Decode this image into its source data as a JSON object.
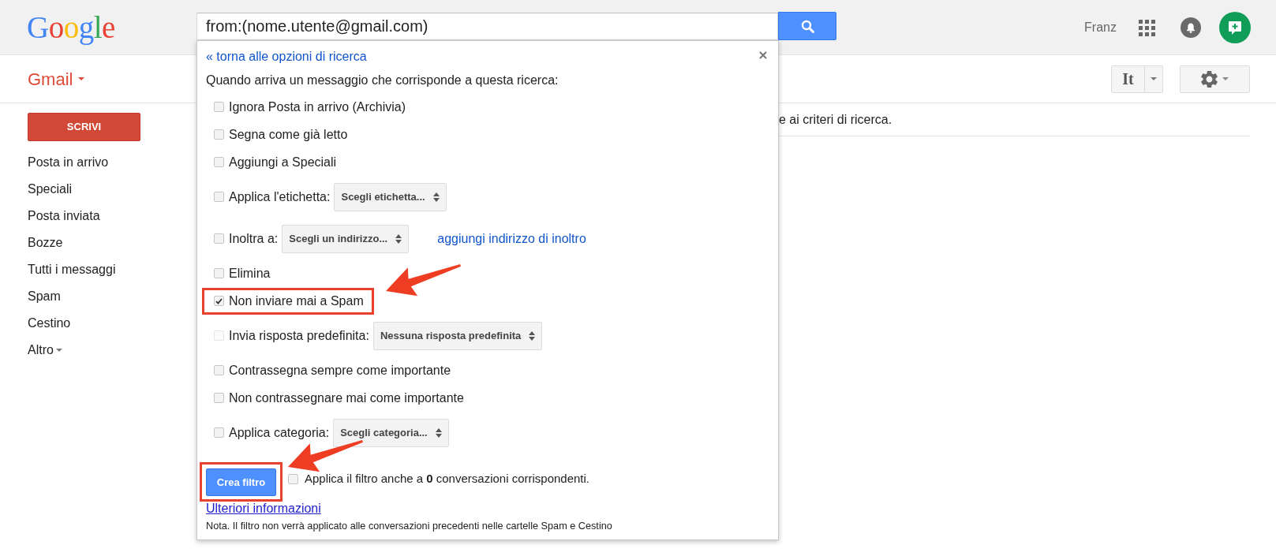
{
  "header": {
    "logo": "Google",
    "search": {
      "value": "from:(nome.utente@gmail.com)"
    },
    "user_name": "Franz"
  },
  "toolbar": {
    "app_menu": "Gmail",
    "input_tools": "It"
  },
  "sidebar": {
    "compose_button": "SCRIVI",
    "items": [
      {
        "label": "Posta in arrivo",
        "kind": "folder",
        "selected": false
      },
      {
        "label": "Speciali",
        "kind": "folder",
        "selected": false
      },
      {
        "label": "Posta inviata",
        "kind": "folder",
        "selected": false
      },
      {
        "label": "Bozze",
        "kind": "folder",
        "selected": false
      },
      {
        "label": "Tutti i messaggi",
        "kind": "folder",
        "selected": false
      },
      {
        "label": "Spam",
        "kind": "folder",
        "selected": false
      },
      {
        "label": "Cestino",
        "kind": "folder",
        "selected": false
      },
      {
        "label": "Altro",
        "kind": "dropdown",
        "selected": false
      }
    ]
  },
  "main": {
    "message": "e ai criteri di ricerca."
  },
  "filter_dialog": {
    "back_link": "« torna alle opzioni di ricerca",
    "intro": "Quando arriva un messaggio che corrisponde a questa ricerca:",
    "options": [
      {
        "kind": "plain",
        "label": "Ignora Posta in arrivo (Archivia)",
        "checked": false,
        "disabled": false,
        "highlighted": false
      },
      {
        "kind": "plain",
        "label": "Segna come già letto",
        "checked": false,
        "disabled": false,
        "highlighted": false
      },
      {
        "kind": "plain",
        "label": "Aggiungi a Speciali",
        "checked": false,
        "disabled": false,
        "highlighted": false
      },
      {
        "kind": "select",
        "label": "Applica l'etichetta:",
        "select": "Scegli etichetta...",
        "checked": false,
        "disabled": false,
        "highlighted": false
      },
      {
        "kind": "select",
        "label": "Inoltra a:",
        "select": "Scegli un indirizzo...",
        "link": "aggiungi indirizzo di inoltro",
        "checked": false,
        "disabled": false,
        "highlighted": false
      },
      {
        "kind": "plain",
        "label": "Elimina",
        "checked": false,
        "disabled": false,
        "highlighted": false
      },
      {
        "kind": "plain",
        "label": "Non inviare mai a Spam",
        "checked": true,
        "disabled": false,
        "highlighted": true
      },
      {
        "kind": "select",
        "label": "Invia risposta predefinita:",
        "select": "Nessuna risposta predefinita",
        "checked": false,
        "disabled": true,
        "highlighted": false
      },
      {
        "kind": "plain",
        "label": "Contrassegna sempre come importante",
        "checked": false,
        "disabled": false,
        "highlighted": false
      },
      {
        "kind": "plain",
        "label": "Non contrassegnare mai come importante",
        "checked": false,
        "disabled": false,
        "highlighted": false
      },
      {
        "kind": "select",
        "label": "Applica categoria:",
        "select": "Scegli categoria...",
        "checked": false,
        "disabled": false,
        "highlighted": false
      }
    ],
    "create_button": {
      "label": "Crea filtro",
      "highlighted": true
    },
    "apply_existing": {
      "label": "Applica il filtro anche a **0** conversazioni corrispondenti.",
      "checked": false
    },
    "more_info_link": "Ulteriori informazioni",
    "note": "Nota. Il filtro non verrà applicato alle conversazioni precedenti nelle cartelle Spam e Cestino"
  }
}
